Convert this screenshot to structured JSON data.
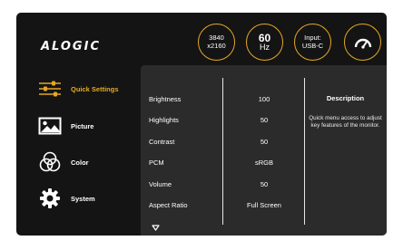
{
  "brand": {
    "logo_text": "ALOGIC",
    "accent_color": "#e5a823"
  },
  "status": {
    "resolution_line1": "3840",
    "resolution_line2": "x2160",
    "refresh_value": "60",
    "refresh_unit": "Hz",
    "input_label": "Input:",
    "input_value": "USB-C",
    "gauge_icon": "speedometer-icon"
  },
  "sidebar": {
    "items": [
      {
        "label": "Quick Settings",
        "icon": "sliders-icon",
        "active": true
      },
      {
        "label": "Picture",
        "icon": "picture-icon",
        "active": false
      },
      {
        "label": "Color",
        "icon": "color-circles-icon",
        "active": false
      },
      {
        "label": "System",
        "icon": "gear-icon",
        "active": false
      }
    ]
  },
  "settings": {
    "rows": [
      {
        "name": "Brightness",
        "value": "100"
      },
      {
        "name": "Highlights",
        "value": "50"
      },
      {
        "name": "Contrast",
        "value": "50"
      },
      {
        "name": "PCM",
        "value": "sRGB"
      },
      {
        "name": "Volume",
        "value": "50"
      },
      {
        "name": "Aspect Ratio",
        "value": "Full Screen"
      }
    ],
    "more_icon": "chevron-down-icon"
  },
  "description": {
    "title": "Description",
    "text": "Quick menu access to adjust key features of the monitor."
  }
}
